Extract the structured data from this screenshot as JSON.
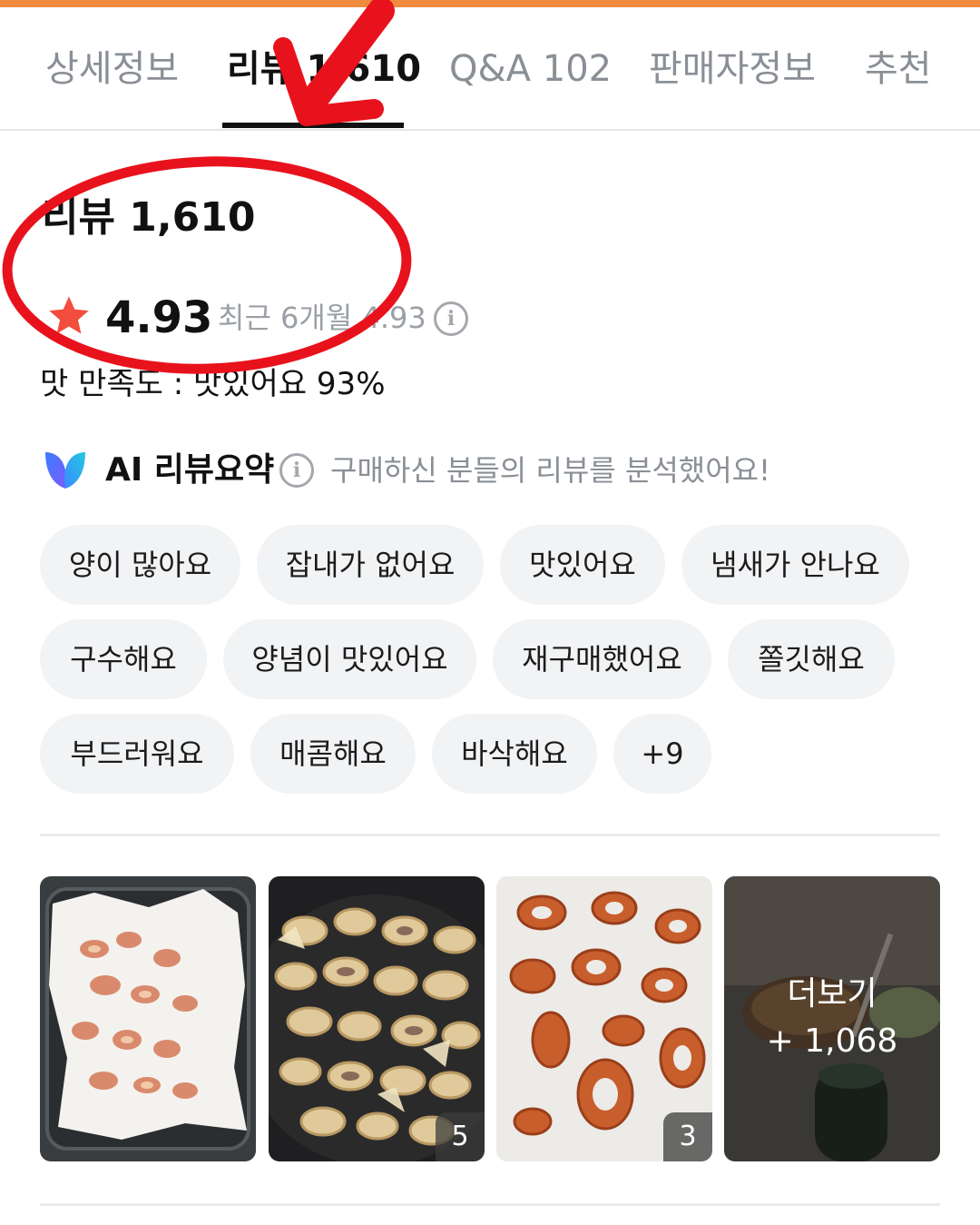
{
  "tabs": [
    {
      "label": "상세정보",
      "active": false
    },
    {
      "label": "리뷰 1,610",
      "active": true
    },
    {
      "label": "Q&A 102",
      "active": false
    },
    {
      "label": "판매자정보",
      "active": false
    },
    {
      "label": "추천",
      "active": false
    }
  ],
  "review": {
    "title": "리뷰 1,610",
    "rating": "4.93",
    "recent_rating": "최근 6개월 4.93",
    "taste_satisfaction": "맛 만족도 : 맛있어요 93%"
  },
  "ai_summary": {
    "title": "AI 리뷰요약",
    "description": "구매하신 분들의 리뷰를 분석했어요!",
    "tags": [
      "양이 많아요",
      "잡내가 없어요",
      "맛있어요",
      "냄새가 안나요",
      "구수해요",
      "양념이 맛있어요",
      "재구매했어요",
      "쫄깃해요",
      "부드러워요",
      "매콤해요",
      "바삭해요",
      "+9"
    ]
  },
  "photos": {
    "items": [
      {
        "badge": ""
      },
      {
        "badge": "5"
      },
      {
        "badge": "3"
      }
    ],
    "more_label": "더보기",
    "more_count": "+ 1,068"
  },
  "colors": {
    "accent_orange": "#f08a3c",
    "star_red": "#f24d3d",
    "annotation_red": "#e8121c",
    "chip_bg": "#f2f3f5"
  },
  "icons": [
    "star-icon",
    "info-icon",
    "ai-logo-icon"
  ]
}
